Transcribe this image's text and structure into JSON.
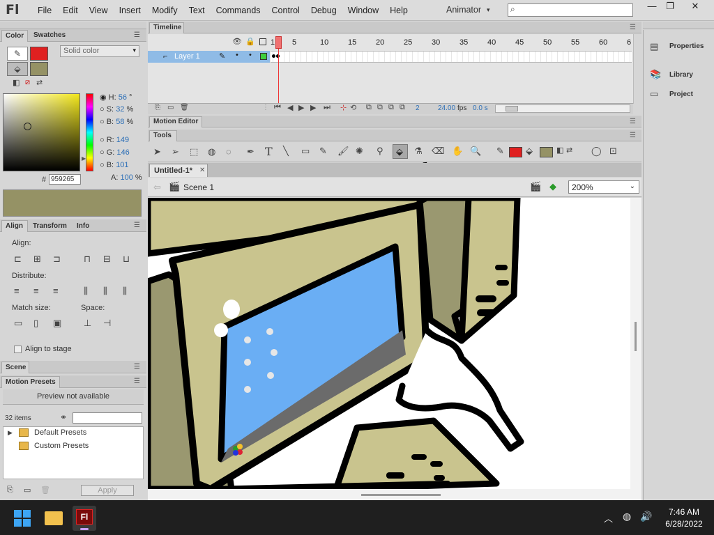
{
  "app": {
    "logo": "Fl",
    "workspace": "Animator",
    "search_placeholder": ""
  },
  "menu": [
    "File",
    "Edit",
    "View",
    "Insert",
    "Modify",
    "Text",
    "Commands",
    "Control",
    "Debug",
    "Window",
    "Help"
  ],
  "window_buttons": {
    "minimize": "—",
    "restore": "❐",
    "close": "✕"
  },
  "color_panel": {
    "tabs": [
      "Color",
      "Swatches"
    ],
    "fill_type": "Solid color",
    "stroke_color": "#e02020",
    "fill_color": "#959265",
    "hsb": {
      "h_label": "H:",
      "h": "56",
      "h_unit": "°",
      "s_label": "S:",
      "s": "32",
      "s_unit": "%",
      "b_label": "B:",
      "b": "58",
      "b_unit": "%"
    },
    "rgb": {
      "r_label": "R:",
      "r": "149",
      "g_label": "G:",
      "g": "146",
      "b_label": "B:",
      "b": "101"
    },
    "alpha": {
      "label": "A:",
      "value": "100",
      "unit": "%"
    },
    "hex_label": "#",
    "hex": "959265"
  },
  "align_panel": {
    "tabs": [
      "Align",
      "Transform",
      "Info"
    ],
    "align_label": "Align:",
    "distribute_label": "Distribute:",
    "match_size_label": "Match size:",
    "space_label": "Space:",
    "align_to_stage": "Align to stage"
  },
  "scene_panel": {
    "title": "Scene"
  },
  "motion_presets": {
    "title": "Motion Presets",
    "preview": "Preview not available",
    "count": "32 items",
    "items": [
      "Default Presets",
      "Custom Presets"
    ],
    "apply": "Apply"
  },
  "timeline": {
    "title": "Timeline",
    "layer": "Layer 1",
    "frame_numbers": [
      "1",
      "5",
      "10",
      "15",
      "20",
      "25",
      "30",
      "35",
      "40",
      "45",
      "50",
      "55",
      "60",
      "6"
    ],
    "current_frame": "2",
    "fps": "24.00",
    "fps_unit": "fps",
    "time": "0.0 s"
  },
  "motion_editor": {
    "title": "Motion Editor"
  },
  "tools": {
    "title": "Tools",
    "fill_swatch": "#959265",
    "stroke_swatch": "#e02020"
  },
  "document": {
    "tab": "Untitled-1*",
    "close": "✕",
    "scene": "Scene 1",
    "zoom": "200%"
  },
  "right_panel": {
    "items": [
      "Properties",
      "Library",
      "Project"
    ]
  },
  "taskbar": {
    "time": "7:46 AM",
    "date": "6/28/2022",
    "flash_icon_label": "Fl"
  },
  "colors": {
    "screen_blue": "#6aaef4",
    "monitor_khaki": "#c9c48e",
    "accent_red": "#e02020"
  }
}
